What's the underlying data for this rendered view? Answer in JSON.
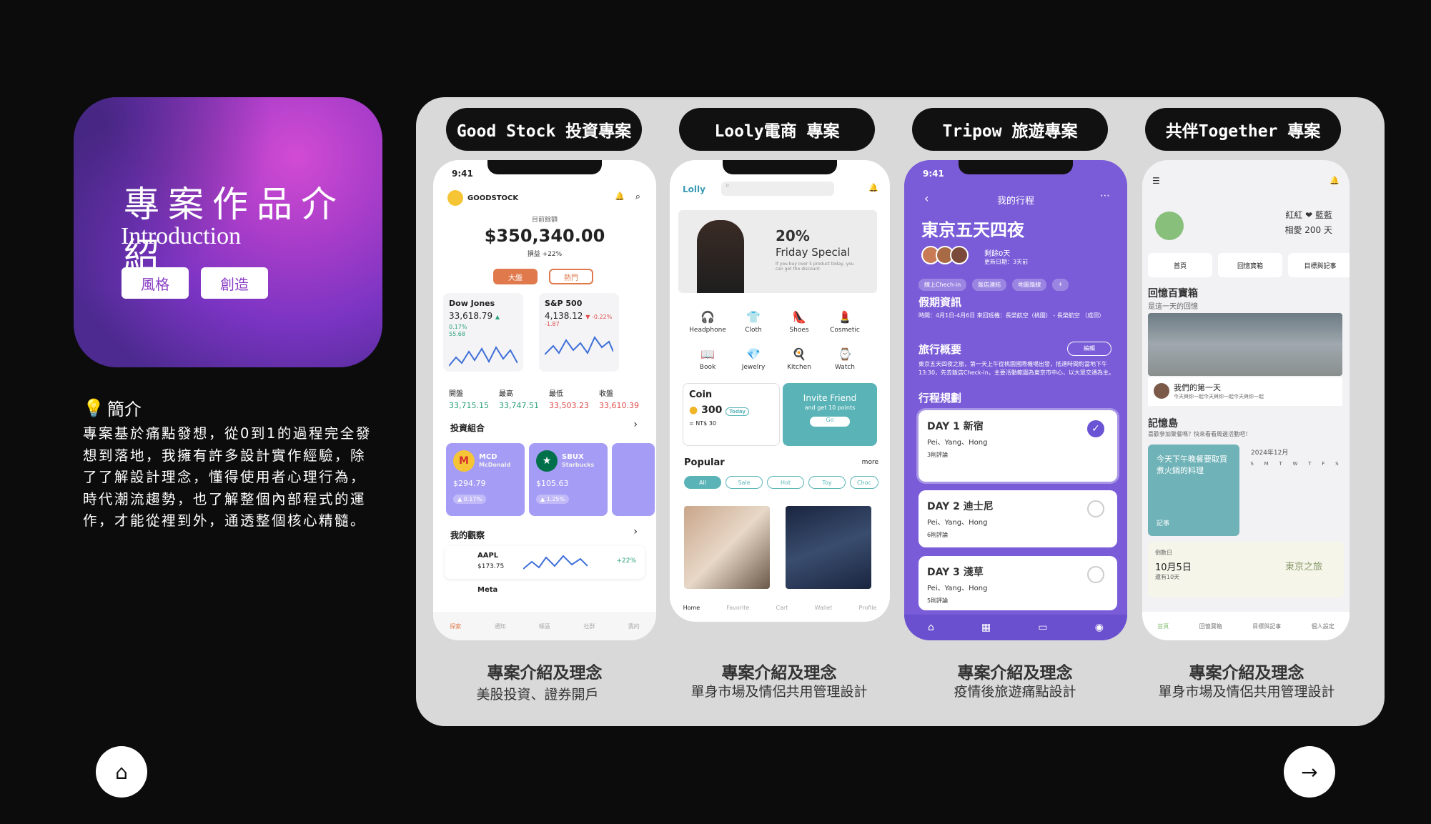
{
  "intro": {
    "title": "專案作品介紹",
    "subtitle": "Introduction",
    "tags": [
      "風格",
      "創造"
    ]
  },
  "bio": {
    "heading": "簡介",
    "text": "專案基於痛點發想，從0到1的過程完全發想到落地，我擁有許多設計實作經驗，除了了解設計理念，懂得使用者心理行為，時代潮流趨勢，也了解整個內部程式的運作，才能從裡到外，通透整個核心精髓。"
  },
  "projects": [
    {
      "pill": "Good Stock 投資專案",
      "caption_title": "專案介紹及理念",
      "caption_sub": "美股投資、證券開戶"
    },
    {
      "pill": "Looly電商 專案",
      "caption_title": "專案介紹及理念",
      "caption_sub": "單身市場及情侶共用管理設計"
    },
    {
      "pill": "Tripow 旅遊專案",
      "caption_title": "專案介紹及理念",
      "caption_sub": "疫情後旅遊痛點設計"
    },
    {
      "pill": "共伴Together 專案",
      "caption_title": "專案介紹及理念",
      "caption_sub": "單身市場及情侶共用管理設計"
    }
  ],
  "phone1": {
    "time": "9:41",
    "brand": "GOODSTOCK",
    "balance_label": "目前餘額",
    "balance": "$350,340.00",
    "gain": "損益 +22%",
    "seg_active": "大盤",
    "seg_inactive": "熱門",
    "indices": [
      {
        "name": "Dow Jones",
        "value": "33,618.79",
        "change": "▲ 0.17%",
        "sub": "55.68"
      },
      {
        "name": "S&P 500",
        "value": "4,138.12",
        "change": "▼ -0.22%",
        "sub": "-1.87"
      }
    ],
    "stats": [
      {
        "label": "開盤",
        "value": "33,715.15"
      },
      {
        "label": "最高",
        "value": "33,747.51"
      },
      {
        "label": "最低",
        "value": "33,503.23"
      },
      {
        "label": "收盤",
        "value": "33,610.39"
      }
    ],
    "portfolio_label": "投資組合",
    "stocks": [
      {
        "icon": "M",
        "name": "MCD",
        "full": "McDonald",
        "value": "$294.79",
        "change": "▲ 0.17%"
      },
      {
        "icon": "★",
        "name": "SBUX",
        "full": "Starbucks",
        "value": "$105.63",
        "change": "▲ 1.25%"
      }
    ],
    "watch_label": "我的觀察",
    "watch": [
      {
        "name": "AAPL",
        "value": "$173.75",
        "change": "+22%"
      },
      {
        "name": "Meta"
      }
    ],
    "tabs": [
      "探索",
      "通知",
      "帳區",
      "社群",
      "我的"
    ]
  },
  "phone2": {
    "brand": "Lolly",
    "banner_pct": "20%",
    "banner_title": "Friday Special",
    "banner_note": "If you buy over 5 product today, you can get the discount.",
    "categories": [
      {
        "icon": "🎧",
        "label": "Headphone"
      },
      {
        "icon": "👕",
        "label": "Cloth"
      },
      {
        "icon": "👠",
        "label": "Shoes"
      },
      {
        "icon": "💄",
        "label": "Cosmetic"
      },
      {
        "icon": "📖",
        "label": "Book"
      },
      {
        "icon": "💎",
        "label": "Jewelry"
      },
      {
        "icon": "🍳",
        "label": "Kitchen"
      },
      {
        "icon": "⌚",
        "label": "Watch"
      }
    ],
    "coin_label": "Coin",
    "coin_value": "300",
    "coin_sub": "= NT$ 30",
    "coin_today": "Today",
    "invite_title": "Invite Friend",
    "invite_sub": "and get 10 points",
    "invite_go": "Go",
    "popular_label": "Popular",
    "popular_more": "more",
    "chips": [
      "All",
      "Sale",
      "Hot",
      "Toy",
      "Choc"
    ],
    "tabs": [
      "Home",
      "Favorite",
      "Cart",
      "Wallet",
      "Profile"
    ]
  },
  "phone3": {
    "time": "9:41",
    "header": "我的行程",
    "title": "東京五天四夜",
    "days_left": "剩餘0天",
    "updated": "更新日期：3天前",
    "chips": [
      "線上Chech-in",
      "飯店連結",
      "地圖路線"
    ],
    "holiday_title": "假期資訊",
    "holiday_desc": "時間：4月1日-4月6日 來回班機：長榮航空（桃園） - 長榮航空 （成田）",
    "overview_title": "旅行概要",
    "overview_edit": "編輯",
    "overview_desc": "東京五天四夜之旅，第一天上午從桃園國際機場出發，抵達時間約當地下午13:30，先去飯店Check-in，主要活動範圍為東京市中心，以大眾交通為主。",
    "plan_title": "行程規劃",
    "days": [
      {
        "title": "DAY 1 新宿",
        "people": "Pei、Yang、Hong",
        "comments": "3則評論"
      },
      {
        "title": "DAY 2 迪士尼",
        "people": "Pei、Yang、Hong",
        "comments": "6則評論"
      },
      {
        "title": "DAY 3 淺草",
        "people": "Pei、Yang、Hong",
        "comments": "5則評論"
      }
    ]
  },
  "phone4": {
    "couple": "紅紅 ❤ 藍藍",
    "days_together": "相愛 200 天",
    "tabs": [
      "首頁",
      "回憶寶箱",
      "目標與記事",
      "個人設定"
    ],
    "memory_title": "回憶百寶箱",
    "memory_sub": "是這一天的回憶",
    "memory_caption": "我們的第一天",
    "memory_caption_sub": "今天與你一起今天與你一起今天與你一起",
    "island_title": "記憶島",
    "island_sub": "喜歡參加聚餐嗎？快來看看周邊活動吧！",
    "memo_text": "今天下午晚餐要取買煮火鍋的料理",
    "memo_label": "記事",
    "cal_title": "2024年12月",
    "cal_week": [
      "S",
      "M",
      "T",
      "W",
      "T",
      "F",
      "S"
    ],
    "countdown_label": "倒數日",
    "countdown_date": "10月5日",
    "countdown_left": "還有10天",
    "countdown_event": "東京之旅"
  },
  "nav": {
    "home": "⌂",
    "next": "→"
  }
}
